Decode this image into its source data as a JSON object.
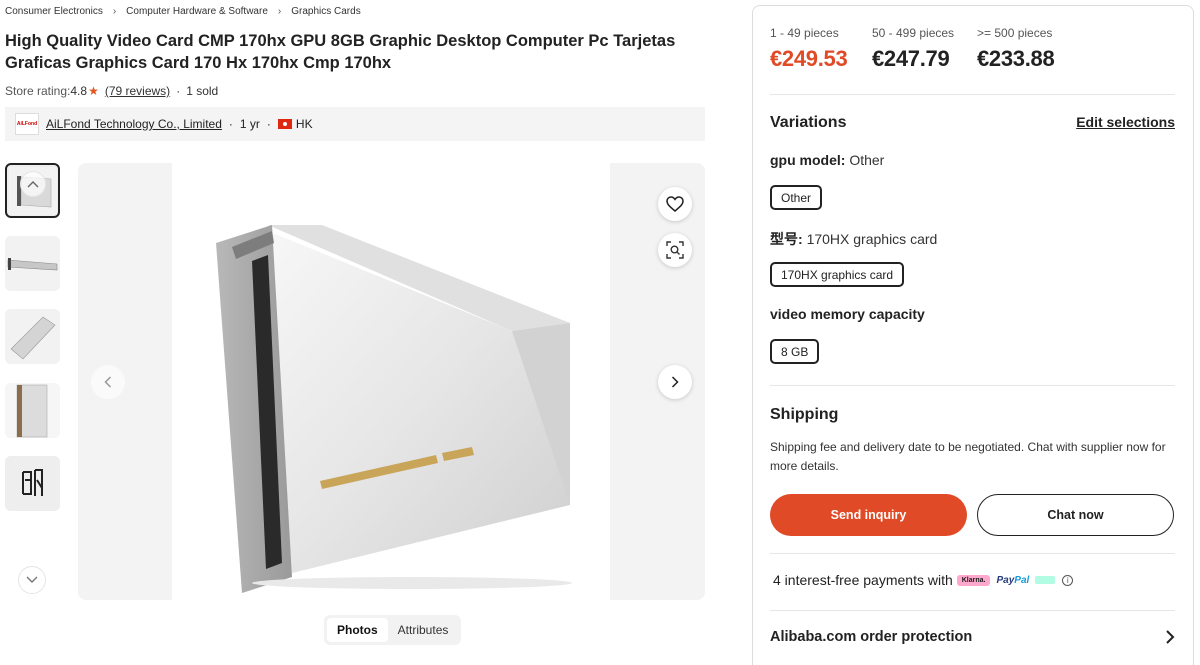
{
  "breadcrumb": [
    "Consumer Electronics",
    "Computer Hardware & Software",
    "Graphics Cards"
  ],
  "product": {
    "title": "High Quality Video Card CMP 170hx GPU 8GB Graphic Desktop Computer Pc Tarjetas Graficas Graphics Card 170 Hx 170hx Cmp 170hx"
  },
  "rating": {
    "label": "Store rating:",
    "score": "4.8",
    "reviews": "(79 reviews)",
    "sold": "1 sold"
  },
  "supplier": {
    "logo_text": "AiLFond",
    "name": "AiLFond Technology Co., Limited",
    "years": "1 yr",
    "country": "HK"
  },
  "media_tabs": [
    "Photos",
    "Attributes"
  ],
  "pricing": [
    {
      "range": "1 - 49 pieces",
      "price": "€249.53"
    },
    {
      "range": "50 - 499 pieces",
      "price": "€247.79"
    },
    {
      "range": ">= 500 pieces",
      "price": "€233.88"
    }
  ],
  "variations": {
    "title": "Variations",
    "edit": "Edit selections",
    "gpu_model_label": "gpu model:",
    "gpu_model_value": "Other",
    "gpu_model_option": "Other",
    "model_label": "型号:",
    "model_value": "170HX graphics card",
    "model_option": "170HX graphics card",
    "memory_label": "video memory capacity",
    "memory_option": "8 GB"
  },
  "shipping": {
    "title": "Shipping",
    "text": "Shipping fee and delivery date to be negotiated. Chat with supplier now for more details."
  },
  "actions": {
    "inquiry": "Send inquiry",
    "chat": "Chat now"
  },
  "payments": {
    "text": "4 interest-free payments with",
    "klarna": "Klarna.",
    "paypal_a": "Pay",
    "paypal_b": "Pal"
  },
  "protection": "Alibaba.com order protection",
  "colors": {
    "price_red": "#e14a26",
    "primary_button": "#e14a26",
    "star": "#e3561d"
  }
}
